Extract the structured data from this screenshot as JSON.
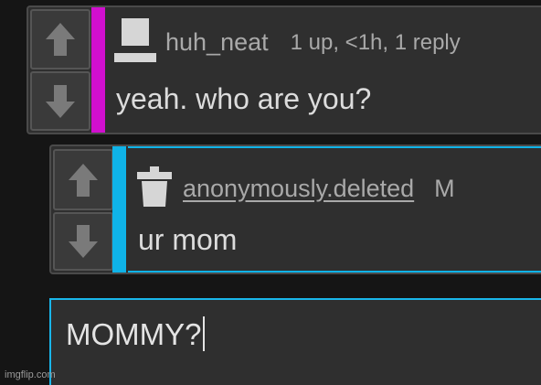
{
  "comments": [
    {
      "username": "huh_neat",
      "meta": "1 up, <1h, 1 reply",
      "text": "yeah. who are you?",
      "stripe_color": "#d10fcf",
      "avatar_icon": "user-avatar-icon",
      "upvote_icon": "upvote-arrow-icon",
      "downvote_icon": "downvote-arrow-icon"
    },
    {
      "username": "anonymously.deleted",
      "meta": "M",
      "text": "ur mom",
      "stripe_color": "#0fb3e8",
      "avatar_icon": "deleted-user-icon",
      "upvote_icon": "upvote-arrow-icon",
      "downvote_icon": "downvote-arrow-icon"
    }
  ],
  "reply_box": {
    "value": "MOMMY?",
    "border_color": "#19b6ea"
  },
  "watermark": "imgflip.com"
}
